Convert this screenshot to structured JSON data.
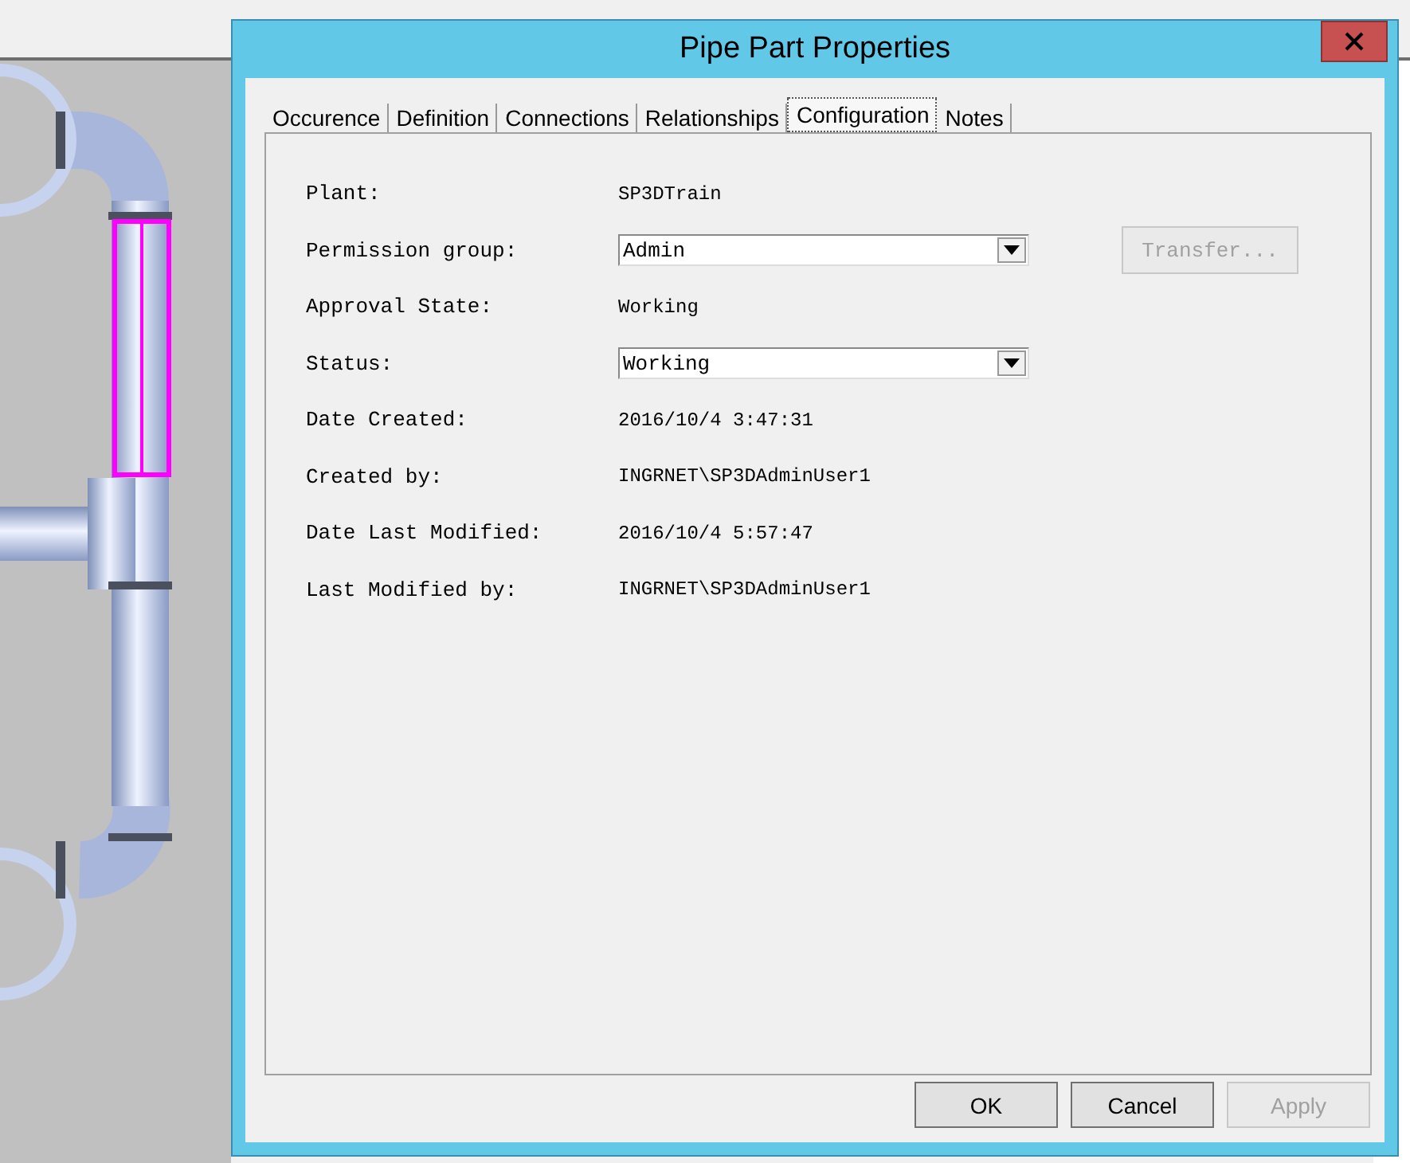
{
  "window": {
    "title": "Pipe Part Properties"
  },
  "tabs": [
    {
      "label": "Occurence",
      "selected": false
    },
    {
      "label": "Definition",
      "selected": false
    },
    {
      "label": "Connections",
      "selected": false
    },
    {
      "label": "Relationships",
      "selected": false
    },
    {
      "label": "Configuration",
      "selected": true
    },
    {
      "label": "Notes",
      "selected": false
    }
  ],
  "fields": [
    {
      "label": "Plant:",
      "value": "SP3DTrain",
      "kind": "text"
    },
    {
      "label": "Permission group:",
      "value": "Admin",
      "kind": "dropdown"
    },
    {
      "label": "Approval State:",
      "value": "Working",
      "kind": "text"
    },
    {
      "label": "Status:",
      "value": "Working",
      "kind": "dropdown"
    },
    {
      "label": "Date Created:",
      "value": "2016/10/4 3:47:31",
      "kind": "text"
    },
    {
      "label": "Created by:",
      "value": "INGRNET\\SP3DAdminUser1",
      "kind": "text"
    },
    {
      "label": "Date Last Modified:",
      "value": "2016/10/4 5:57:47",
      "kind": "text"
    },
    {
      "label": "Last Modified by:",
      "value": "INGRNET\\SP3DAdminUser1",
      "kind": "text"
    }
  ],
  "transfer_button": {
    "label": "Transfer...",
    "disabled": true
  },
  "buttons": [
    {
      "label": "OK",
      "disabled": false
    },
    {
      "label": "Cancel",
      "disabled": false
    },
    {
      "label": "Apply",
      "disabled": true
    }
  ]
}
